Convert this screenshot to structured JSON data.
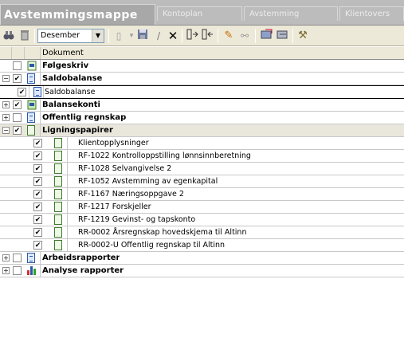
{
  "app": {
    "tabs": [
      {
        "label": "Avstemmingsmappe",
        "active": true
      },
      {
        "label": "Kontoplan",
        "active": false
      },
      {
        "label": "Avstemming",
        "active": false
      },
      {
        "label": "Klientovers",
        "active": false
      }
    ]
  },
  "toolbar": {
    "month_value": "Desember",
    "icons": [
      "binoculars-icon",
      "trash-icon",
      "new-document-icon",
      "save-icon",
      "edit-icon",
      "delete-icon",
      "import-icon",
      "export-icon",
      "pencil-icon",
      "unlink-icon",
      "folder-in-icon",
      "folder-out-icon",
      "tools-icon"
    ]
  },
  "grid": {
    "header": "Dokument",
    "rows": [
      {
        "id": "folgeskriv",
        "label": "Følgeskriv",
        "level": 0,
        "expander": "",
        "checked": false,
        "icon": "green-doc-icon"
      },
      {
        "id": "saldobalanse",
        "label": "Saldobalanse",
        "level": 0,
        "expander": "−",
        "checked": true,
        "icon": "blue-doc-icon"
      },
      {
        "id": "saldobalanse-child",
        "label": "Saldobalanse",
        "level": 1,
        "expander": "",
        "checked": true,
        "icon": "blue-doc-icon"
      },
      {
        "id": "balansekonti",
        "label": "Balansekonti",
        "level": 0,
        "expander": "+",
        "checked": true,
        "icon": "green-doc-icon"
      },
      {
        "id": "offentlig",
        "label": "Offentlig regnskap",
        "level": 0,
        "expander": "+",
        "checked": false,
        "icon": "blue-doc-icon"
      },
      {
        "id": "ligning",
        "label": "Ligningspapirer",
        "level": 0,
        "expander": "−",
        "checked": true,
        "icon": "green-doc-icon"
      },
      {
        "id": "c1",
        "label": "Klientopplysninger",
        "level": 2,
        "checked": true,
        "icon": "green-doc-icon"
      },
      {
        "id": "c2",
        "label": "RF-1022 Kontrolloppstilling lønnsinnberetning",
        "level": 2,
        "checked": true,
        "icon": "green-doc-icon"
      },
      {
        "id": "c3",
        "label": "RF-1028 Selvangivelse 2",
        "level": 2,
        "checked": true,
        "icon": "green-doc-icon"
      },
      {
        "id": "c4",
        "label": "RF-1052 Avstemming av egenkapital",
        "level": 2,
        "checked": true,
        "icon": "green-doc-icon"
      },
      {
        "id": "c5",
        "label": "RF-1167 Næringsoppgave 2",
        "level": 2,
        "checked": true,
        "icon": "green-doc-icon"
      },
      {
        "id": "c6",
        "label": "RF-1217 Forskjeller",
        "level": 2,
        "checked": true,
        "icon": "green-doc-icon"
      },
      {
        "id": "c7",
        "label": "RF-1219 Gevinst- og tapskonto",
        "level": 2,
        "checked": true,
        "icon": "green-doc-icon"
      },
      {
        "id": "c8",
        "label": "RR-0002 Årsregnskap hovedskjema til Altinn",
        "level": 2,
        "checked": true,
        "icon": "green-doc-icon"
      },
      {
        "id": "c9",
        "label": "RR-0002-U Offentlig regnskap til Altinn",
        "level": 2,
        "checked": true,
        "icon": "green-doc-icon"
      },
      {
        "id": "arbeid",
        "label": "Arbeidsrapporter",
        "level": 0,
        "expander": "+",
        "checked": false,
        "icon": "blue-doc-icon"
      },
      {
        "id": "analyse",
        "label": "Analyse rapporter",
        "level": 0,
        "expander": "+",
        "checked": false,
        "icon": "chart-icon"
      }
    ]
  }
}
